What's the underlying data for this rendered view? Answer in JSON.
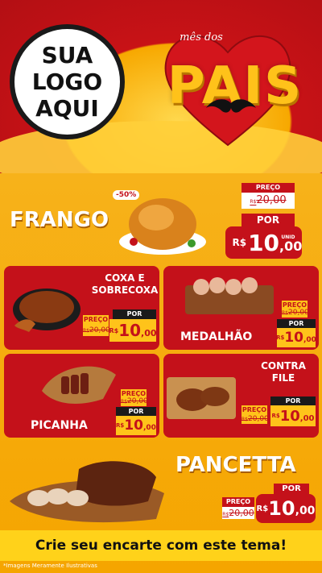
{
  "header": {
    "logo_lines": [
      "SUA",
      "LOGO",
      "AQUI"
    ],
    "mes_dos": "mês dos",
    "title": "PAIS"
  },
  "frango": {
    "name": "FRANGO",
    "discount": "-50%",
    "preco_label": "PREÇO",
    "old_currency": "R$",
    "old_price": "20,00",
    "por_label": "POR",
    "currency": "R$",
    "price_int": "10",
    "price_dec": ",00",
    "unit": "UNID"
  },
  "coxa": {
    "name_line1": "COXA E",
    "name_line2": "SOBRECOXA",
    "preco_label": "PREÇO",
    "old_currency": "R$",
    "old_price": "20,00",
    "por_label": "POR",
    "currency": "R$",
    "price_int": "10",
    "price_dec": ",00",
    "unit": "UNID"
  },
  "medalhao": {
    "name": "MEDALHÃO",
    "preco_label": "PREÇO",
    "old_currency": "R$",
    "old_price": "20,00",
    "por_label": "POR",
    "currency": "R$",
    "price_int": "10",
    "price_dec": ",00",
    "unit": "KG"
  },
  "picanha": {
    "name": "PICANHA",
    "preco_label": "PREÇO",
    "old_currency": "R$",
    "old_price": "20,00",
    "por_label": "POR",
    "currency": "R$",
    "price_int": "10",
    "price_dec": ",00",
    "unit": "KG"
  },
  "contrafile": {
    "name_line1": "CONTRA",
    "name_line2": "FILE",
    "preco_label": "PREÇO",
    "old_currency": "R$",
    "old_price": "20,00",
    "por_label": "POR",
    "currency": "R$",
    "price_int": "10",
    "price_dec": ",00",
    "unit": "KG"
  },
  "pancetta": {
    "name": "PANCETTA",
    "preco_label": "PREÇO",
    "old_currency": "R$",
    "old_price": "20,00",
    "por_label": "POR",
    "currency": "R$",
    "price_int": "10",
    "price_dec": ",00",
    "unit": "KG"
  },
  "cta": "Crie seu encarte com este tema!",
  "footnote": "*Imagens Meramente Ilustrativas",
  "colors": {
    "red": "#c4111a",
    "yellow": "#ffc31a",
    "orange": "#f5a500"
  }
}
